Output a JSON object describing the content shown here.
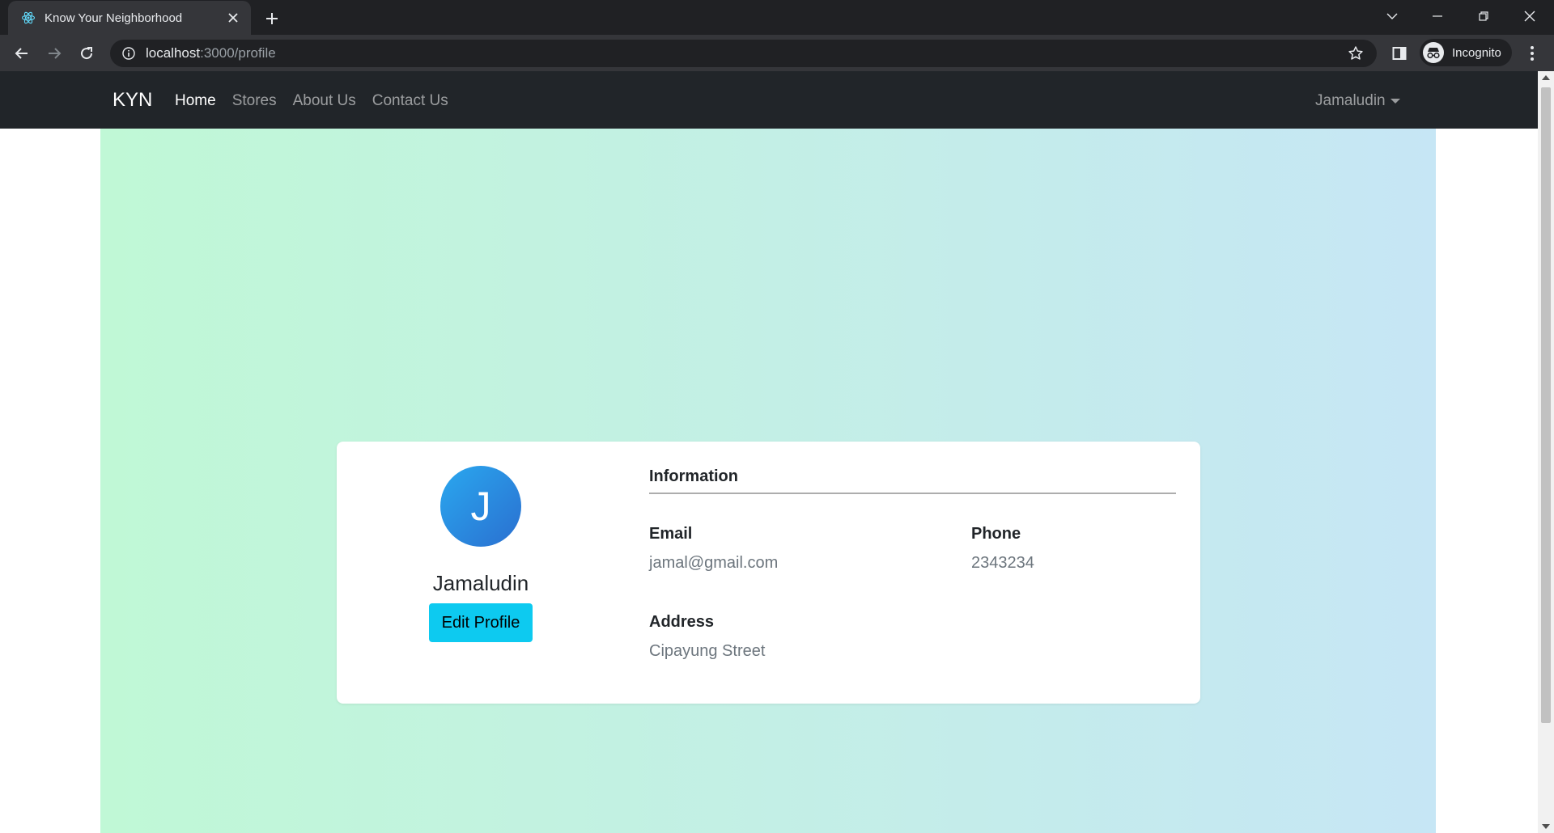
{
  "browser": {
    "tab_title": "Know Your Neighborhood",
    "url_host": "localhost",
    "url_path": ":3000/profile",
    "profile_label": "Incognito"
  },
  "icons": {
    "favicon": "react-icon",
    "tab_close": "close-icon",
    "new_tab": "plus-icon",
    "tab_search": "chevron-down-icon",
    "minimize": "minimize-icon",
    "restore": "restore-icon",
    "window_close": "close-icon",
    "back": "arrow-left-icon",
    "forward": "arrow-right-icon",
    "reload": "reload-icon",
    "site_info": "info-icon",
    "bookmark": "star-icon",
    "side_panel": "side-panel-icon",
    "incognito": "incognito-icon",
    "menu": "kebab-menu-icon"
  },
  "app": {
    "brand": "KYN",
    "nav": [
      {
        "label": "Home",
        "active": true
      },
      {
        "label": "Stores",
        "active": false
      },
      {
        "label": "About Us",
        "active": false
      },
      {
        "label": "Contact Us",
        "active": false
      }
    ],
    "user_menu": "Jamaludin"
  },
  "profile": {
    "avatar_initial": "J",
    "name": "Jamaludin",
    "edit_button": "Edit Profile",
    "section_title": "Information",
    "fields": {
      "email": {
        "label": "Email",
        "value": "jamal@gmail.com"
      },
      "phone": {
        "label": "Phone",
        "value": "2343234"
      },
      "address": {
        "label": "Address",
        "value": "Cipayung Street"
      }
    }
  },
  "colors": {
    "navbar_bg": "#212529",
    "gradient_start": "#c0f8d6",
    "gradient_end": "#c6e6f5",
    "button_bg": "#0dcaf0",
    "avatar_start": "#2aa8ef",
    "avatar_end": "#2a6fd0"
  }
}
